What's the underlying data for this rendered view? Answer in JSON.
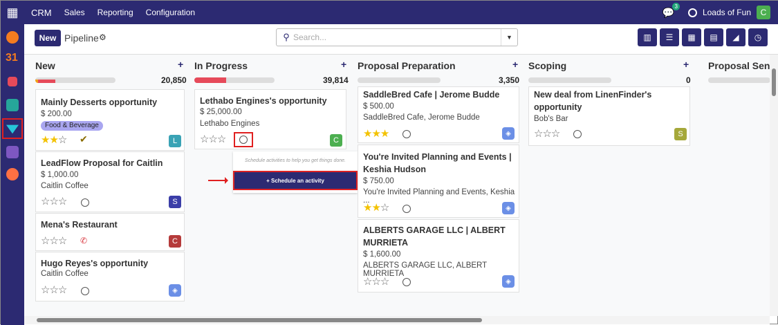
{
  "topbar": {
    "app_name": "CRM",
    "menus": [
      "Sales",
      "Reporting",
      "Configuration"
    ],
    "chat_count": "3",
    "company": "Loads of Fun",
    "user_initial": "C"
  },
  "sidebar": {
    "apps": [
      "discuss",
      "calendar",
      "inbox",
      "contacts",
      "crm",
      "dashboards",
      "apps"
    ],
    "calendar_label": "31"
  },
  "control": {
    "new_label": "New",
    "title": "Pipeline",
    "search_placeholder": "Search...",
    "views": [
      "kanban",
      "list",
      "calendar",
      "pivot",
      "graph",
      "activity"
    ]
  },
  "columns": [
    {
      "name": "New",
      "total": "20,850",
      "progress_red": 0.25,
      "progress_orange": true,
      "cards": [
        {
          "title": "Mainly Desserts opportunity",
          "amount": "$ 200.00",
          "tag": "Food & Beverage",
          "stars": 2,
          "activity": "check",
          "avatar": "L",
          "avatar_color": "#3aa3b5"
        },
        {
          "title": "LeadFlow Proposal for Caitlin",
          "amount": "$ 1,000.00",
          "company": "Caitlin Coffee",
          "stars": 0,
          "activity": "clock",
          "avatar": "S",
          "avatar_color": "#3b3ea8"
        },
        {
          "title": "Mena's Restaurant",
          "stars": 0,
          "activity": "phone",
          "avatar": "C",
          "avatar_color": "#b53b3b"
        },
        {
          "title": "Hugo Reyes's opportunity",
          "company": "Caitlin Coffee",
          "stars": 0,
          "activity": "clock",
          "avatar": "logo"
        }
      ]
    },
    {
      "name": "In Progress",
      "total": "39,814",
      "progress_red": 0.33,
      "cards": [
        {
          "title": "Lethabo Engines's opportunity",
          "amount": "$ 25,000.00",
          "company": "Lethabo Engines",
          "stars": 0,
          "activity": "clock",
          "avatar": "C",
          "avatar_color": "#4caf50"
        }
      ],
      "popup": {
        "hint": "Schedule activities to help you get things done.",
        "button": "+ Schedule an activity"
      }
    },
    {
      "name": "Proposal Preparation",
      "total": "3,350",
      "cards": [
        {
          "title": "SaddleBred Cafe | Jerome Budde",
          "amount": "$ 500.00",
          "company": "SaddleBred Cafe, Jerome Budde",
          "stars": 3,
          "activity": "clock",
          "avatar": "logo"
        },
        {
          "title1": "You're Invited Planning and Events |",
          "title2": "Keshia Hudson",
          "amount": "$ 750.00",
          "company": "You're Invited Planning and Events, Keshia ...",
          "stars": 2,
          "activity": "clock",
          "avatar": "logo"
        },
        {
          "title1": "ALBERTS GARAGE LLC | ALBERT",
          "title2": "MURRIETA",
          "amount": "$ 1,600.00",
          "company": "ALBERTS GARAGE LLC, ALBERT MURRIETA",
          "stars": 0,
          "activity": "clock",
          "avatar": "logo"
        }
      ]
    },
    {
      "name": "Scoping",
      "total": "0",
      "cards": [
        {
          "title1": "New deal from LinenFinder's",
          "title2": "opportunity",
          "company": "Bob's Bar",
          "stars": 0,
          "activity": "clock",
          "avatar": "S",
          "avatar_color": "#a5a83a"
        }
      ]
    },
    {
      "name": "Proposal Sent"
    }
  ]
}
